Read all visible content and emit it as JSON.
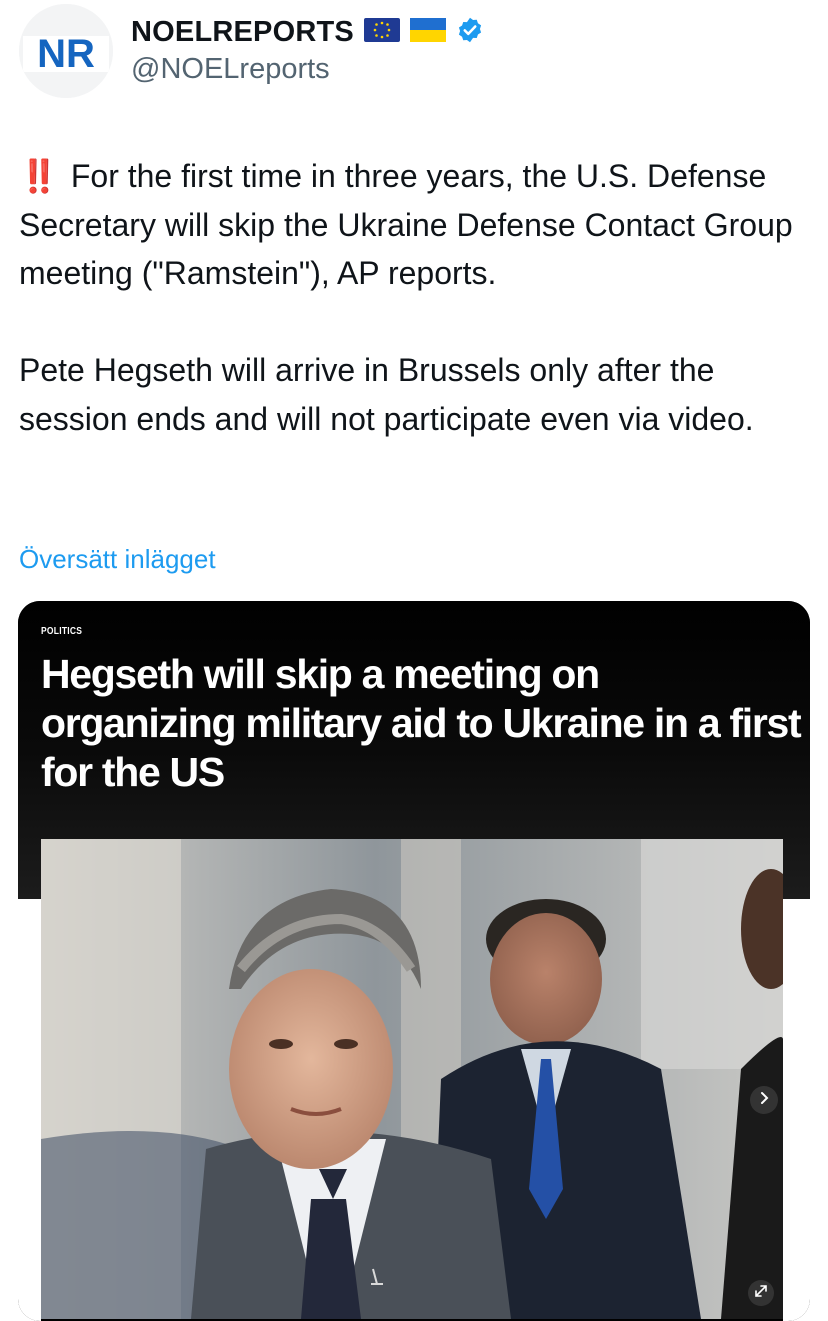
{
  "author": {
    "display_name": "NOELREPORTS",
    "handle": "@NOELreports",
    "avatar_text": "NR",
    "flags": [
      "eu-flag-icon",
      "ukraine-flag-icon"
    ],
    "verified": true
  },
  "tweet": {
    "emoji": "‼️",
    "paragraph_1": "For the first time in three years, the U.S. Defense Secretary will skip the Ukraine Defense Contact Group meeting (\"Ramstein\"), AP reports.",
    "paragraph_2": "Pete Hegseth will arrive in Brussels only after the session ends and will not participate even via video.",
    "translate_label": "Översätt inlägget"
  },
  "media": {
    "kicker": "POLITICS",
    "headline": "Hegseth will skip a meeting on organizing military aid to Ukraine in a first for the US",
    "icons": [
      "chevron-right-icon",
      "expand-icon"
    ]
  },
  "colors": {
    "link": "#1d9bf0",
    "verified": "#1d9bf0",
    "secondary_text": "#536471",
    "avatar_blue": "#1565c0"
  }
}
